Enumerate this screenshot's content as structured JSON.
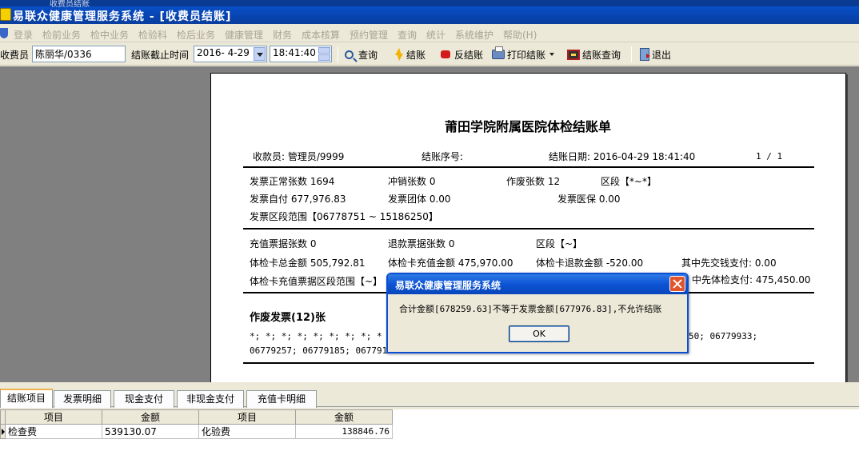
{
  "window": {
    "strip_text": "收费员结账",
    "title": "易联众健康管理服务系统 - [收费员结账]"
  },
  "menu": [
    "登录",
    "检前业务",
    "检中业务",
    "检验科",
    "检后业务",
    "健康管理",
    "财务",
    "成本核算",
    "预约管理",
    "查询",
    "统计",
    "系统维护",
    "帮助(H)"
  ],
  "toolbar": {
    "cashier_label": "收费员",
    "cashier_value": "陈丽华/0336",
    "cutoff_label": "结账截止时间",
    "date_value": "2016- 4-29",
    "time_value": "18:41:40",
    "query_label": "查询",
    "settle_label": "结账",
    "reverse_label": "反结账",
    "print_label": "打印结账",
    "settle_query_label": "结账查询",
    "exit_label": "退出"
  },
  "report": {
    "title": "莆田学院附属医院体检结账单",
    "cashier": "收款员: 管理员/9999",
    "serial": "结账序号:",
    "date": "结账日期: 2016-04-29 18:41:40",
    "page": "1 / 1",
    "normal_count": "发票正常张数 1694",
    "reversed_count": "冲销张数 0",
    "void_count": "作废张数 12",
    "section_range": "区段【*~*】",
    "self_pay": "发票自付 677,976.83",
    "group_pay": "发票团体 0.00",
    "insurance_pay": "发票医保 0.00",
    "invoice_range": "发票区段范围【06778751 ~ 15186250】",
    "recharge_count": "充值票据张数 0",
    "refund_count": "退款票据张数 0",
    "recharge_range": "区段【~】",
    "card_total": "体检卡总金额 505,792.81",
    "card_recharge": "体检卡充值金额 475,970.00",
    "card_refund": "体检卡退款金额 -520.00",
    "prepaid_pay": "其中先交钱支付: 0.00",
    "card_range": "体检卡充值票据区段范围【~】",
    "prepaid_exam": "中先体检支付: 475,450.00",
    "void_heading": "作废发票(12)张",
    "void_line1_left": "*; *; *; *; *; *; *; *; *",
    "void_line1_right": "50; 06779933;",
    "void_line2": "06779257; 06779185; 067791"
  },
  "dialog": {
    "title": "易联众健康管理服务系统",
    "message": "合计金额[678259.63]不等于发票金额[677976.83],不允许结账",
    "ok": "OK"
  },
  "tabs": [
    "结账项目",
    "发票明细",
    "现金支付",
    "非现金支付",
    "充值卡明细"
  ],
  "grid": {
    "headers": [
      "项目",
      "金额",
      "项目",
      "金额"
    ],
    "row": [
      "检查费",
      "539130.07",
      "化验费",
      "138846.76"
    ]
  }
}
